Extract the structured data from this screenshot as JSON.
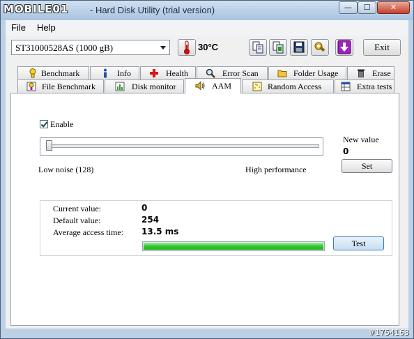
{
  "window": {
    "logo_text": "MOBILE01",
    "title": "- Hard Disk Utility (trial version)",
    "min_glyph": "—",
    "max_glyph": "☐",
    "close_glyph": "✕"
  },
  "menu": {
    "file": "File",
    "help": "Help"
  },
  "toolbar": {
    "drive": "ST31000528AS (1000 gB)",
    "temperature": "30°C",
    "exit_label": "Exit"
  },
  "tabs_row1": [
    {
      "label": "Benchmark",
      "icon": "exclamation-icon"
    },
    {
      "label": "Info",
      "icon": "info-icon"
    },
    {
      "label": "Health",
      "icon": "plus-health-icon"
    },
    {
      "label": "Error Scan",
      "icon": "magnifier-icon"
    },
    {
      "label": "Folder Usage",
      "icon": "folder-icon"
    },
    {
      "label": "Erase",
      "icon": "trash-icon"
    }
  ],
  "tabs_row2": [
    {
      "label": "File Benchmark",
      "icon": "file-benchmark-icon"
    },
    {
      "label": "Disk monitor",
      "icon": "bar-chart-icon"
    },
    {
      "label": "AAM",
      "icon": "speaker-icon",
      "active": true
    },
    {
      "label": "Random Access",
      "icon": "scatter-icon"
    },
    {
      "label": "Extra tests",
      "icon": "table-icon"
    }
  ],
  "aam": {
    "enable_label": "Enable",
    "enabled": true,
    "slider_value": 0,
    "low_label": "Low noise (128)",
    "high_label": "High performance",
    "new_value_label": "New value",
    "new_value": "0",
    "set_label": "Set",
    "current_label": "Current value:",
    "current_value": "0",
    "default_label": "Default value:",
    "default_value": "254",
    "avg_label": "Average access time:",
    "avg_value": "13.5 ms",
    "progress": 1.0,
    "test_label": "Test"
  },
  "watermark": "#1754163",
  "colors": {
    "progress_green": "#2fc72f",
    "close_red": "#c4402b"
  }
}
